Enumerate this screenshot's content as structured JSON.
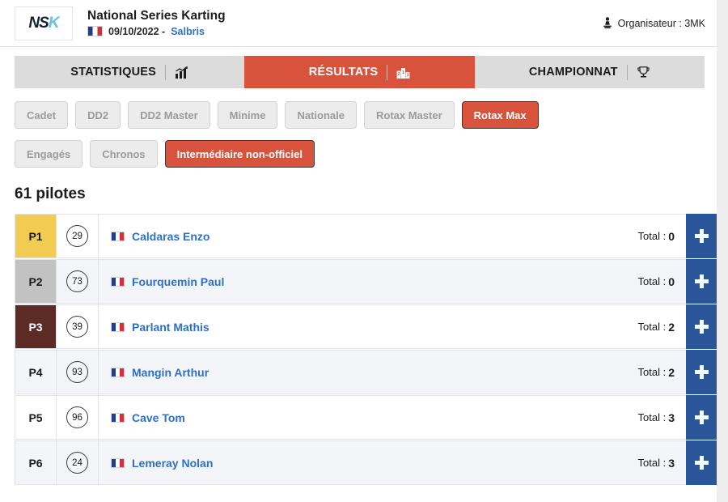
{
  "header": {
    "logo_text_dark": "NS",
    "logo_text_light": "K",
    "logo_icon": "nsk-logo",
    "event_title": "National Series Karting",
    "event_date": "09/10/2022 -",
    "event_city": "Salbris",
    "flag_icon": "french-flag-icon",
    "organiser_icon": "podium-person-icon",
    "organiser_label": "Organisateur : 3MK"
  },
  "tabs": [
    {
      "label": "STATISTIQUES",
      "icon": "bar-chart-icon",
      "active": false
    },
    {
      "label": "RÉSULTATS",
      "icon": "podium-icon",
      "active": true
    },
    {
      "label": "CHAMPIONNAT",
      "icon": "trophy-icon",
      "active": false
    }
  ],
  "category_filters": [
    {
      "label": "Cadet",
      "active": false
    },
    {
      "label": "DD2",
      "active": false
    },
    {
      "label": "DD2 Master",
      "active": false
    },
    {
      "label": "Minime",
      "active": false
    },
    {
      "label": "Nationale",
      "active": false
    },
    {
      "label": "Rotax Master",
      "active": false
    },
    {
      "label": "Rotax Max",
      "active": true
    }
  ],
  "session_filters": [
    {
      "label": "Engagés",
      "active": false
    },
    {
      "label": "Chronos",
      "active": false
    },
    {
      "label": "Intermédiaire non-officiel",
      "active": true
    }
  ],
  "results": {
    "count_heading": "61 pilotes",
    "total_prefix": "Total :",
    "expand_icon": "plus-icon",
    "rows": [
      {
        "position": "P1",
        "medal": "gold",
        "number": "29",
        "flag_icon": "french-flag-icon",
        "pilot": "Caldaras Enzo",
        "total": "0"
      },
      {
        "position": "P2",
        "medal": "silver",
        "number": "73",
        "flag_icon": "french-flag-icon",
        "pilot": "Fourquemin Paul",
        "total": "0"
      },
      {
        "position": "P3",
        "medal": "bronze",
        "number": "39",
        "flag_icon": "french-flag-icon",
        "pilot": "Parlant Mathis",
        "total": "2"
      },
      {
        "position": "P4",
        "medal": "none",
        "number": "93",
        "flag_icon": "french-flag-icon",
        "pilot": "Mangin Arthur",
        "total": "2"
      },
      {
        "position": "P5",
        "medal": "none",
        "number": "96",
        "flag_icon": "french-flag-icon",
        "pilot": "Cave Tom",
        "total": "3"
      },
      {
        "position": "P6",
        "medal": "none",
        "number": "24",
        "flag_icon": "french-flag-icon",
        "pilot": "Lemeray Nolan",
        "total": "3"
      }
    ]
  },
  "colors": {
    "accent_red": "#d9533c",
    "link_blue": "#2f6fc4",
    "button_blue": "#2a5599",
    "gold": "#f2cc52",
    "silver": "#c2c2c2",
    "bronze": "#5d2b26"
  }
}
